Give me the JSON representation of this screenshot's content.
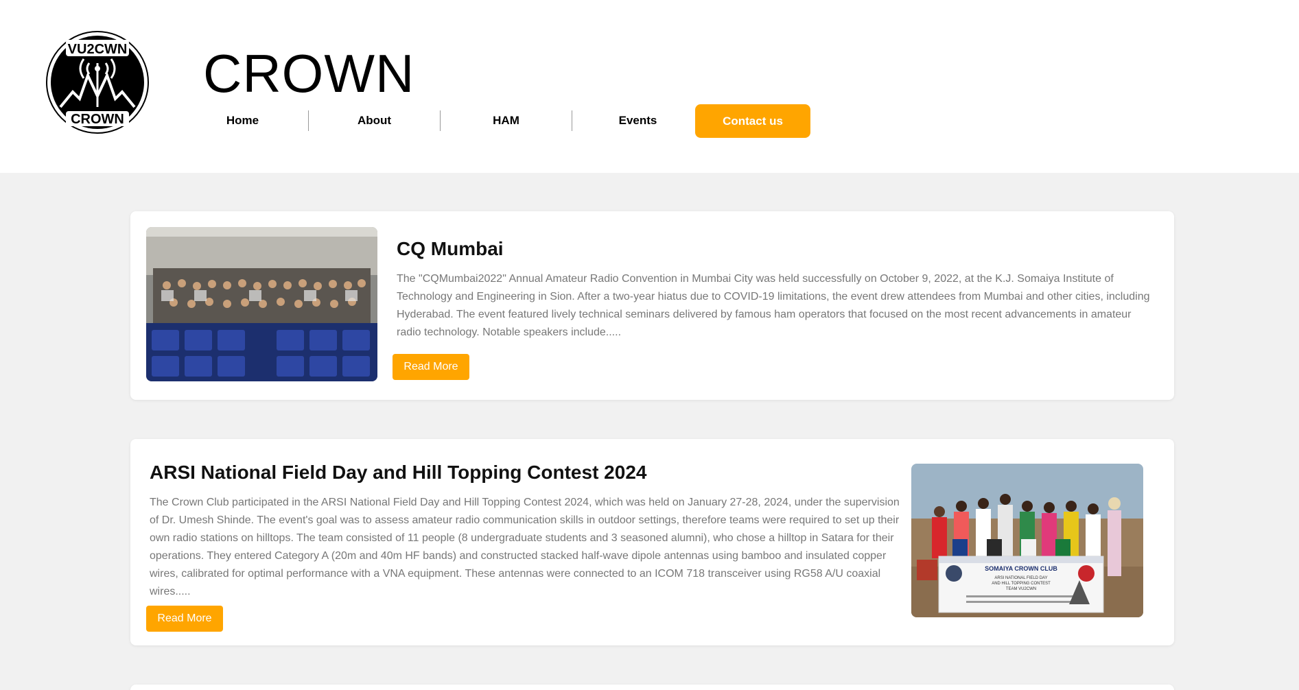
{
  "header": {
    "logo": {
      "icon": "antenna-mountain-logo",
      "top_text": "VU2CWN",
      "bottom_text": "CROWN"
    },
    "brand": "CROWN",
    "nav": [
      "Home",
      "About",
      "HAM",
      "Events"
    ],
    "contact_label": "Contact us"
  },
  "colors": {
    "accent": "#ffa500",
    "page_bg": "#f1f1f1",
    "card_bg": "#ffffff",
    "body_text": "#777777"
  },
  "posts": [
    {
      "title": "CQ Mumbai",
      "text": "The \"CQMumbai2022\" Annual Amateur Radio Convention in Mumbai City was held successfully on October 9, 2022, at the K.J. Somaiya Institute of Technology and Engineering in Sion. After a two-year hiatus due to COVID-19 limitations, the event drew attendees from Mumbai and other cities, including Hyderabad. The event featured lively technical seminars delivered by famous ham operators that focused on the most recent advancements in amateur radio technology. Notable speakers include.....",
      "button": "Read More"
    },
    {
      "title": "ARSI National Field Day and Hill Topping Contest 2024",
      "text": "The Crown Club participated in the ARSI National Field Day and Hill Topping Contest 2024, which was held on January 27-28, 2024, under the supervision of Dr. Umesh Shinde. The event's goal was to assess amateur radio communication skills in outdoor settings, therefore teams were required to set up their own radio stations on hilltops. The team consisted of 11 people (8 undergraduate students and 3 seasoned alumni), who chose a hilltop in Satara for their operations. They entered Category A (20m and 40m HF bands) and constructed stacked half-wave dipole antennas using bamboo and insulated copper wires, calibrated for optimal performance with a VNA equipment. These antennas were connected to an ICOM 718 transceiver using RG58 A/U coaxial wires.....",
      "button": "Read More",
      "banner": {
        "line1": "SOMAIYA CROWN CLUB",
        "line2": "ARSI NATIONAL FIELD DAY",
        "line3": "AND HILL TOPPING CONTEST",
        "line4": "TEAM VU2CWN"
      }
    }
  ]
}
